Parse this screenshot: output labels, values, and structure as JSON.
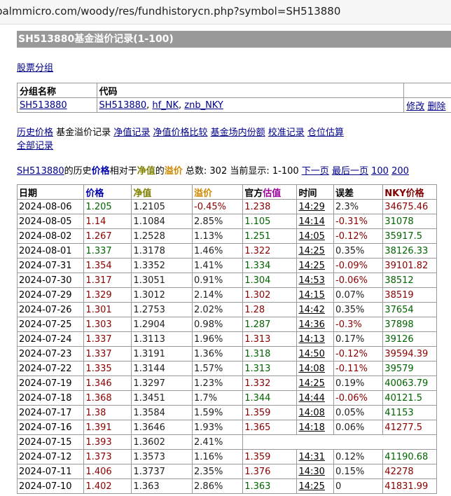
{
  "browser": {
    "url": "palmmicro.com/woody/res/fundhistorycn.php?symbol=SH513880"
  },
  "page_title": "SH513880基金溢价记录(1-100)",
  "group_link": "股票分组",
  "group_table": {
    "headers": [
      "分组名称",
      "代码"
    ],
    "name": "SH513880",
    "codes": [
      "SH513880",
      "hf_NK",
      "znb_NKY"
    ],
    "edit": "修改",
    "delete": "删除"
  },
  "nav_links": [
    "历史价格",
    "基金溢价记录",
    "净值记录",
    "净值价格比较",
    "基金场内份额",
    "校准记录",
    "仓位估算",
    "全部记录"
  ],
  "summary": {
    "symbol": "SH513880",
    "t1": "的历史",
    "price": "价格",
    "t2": "相对于",
    "nav": "净值",
    "t3": "的",
    "premium": "溢价",
    "total": "总数: 302 当前显示: 1-100",
    "next": "下一页",
    "last": "最后一页",
    "n100": "100",
    "n200": "200"
  },
  "table": {
    "headers": {
      "date": "日期",
      "price": "价格",
      "nav": "净值",
      "premium": "溢价",
      "est_prefix": "官方",
      "est": "估值",
      "time": "时间",
      "error": "误差",
      "nky": "NKY价格"
    },
    "rows": [
      {
        "date": "2024-08-06",
        "price": "1.205",
        "price_c": "green",
        "nav": "1.2105",
        "premium": "-0.45%",
        "est": "1.238",
        "est_c": "red",
        "time": "14:29",
        "err": "2.3%",
        "err_c": "dark",
        "nky": "34675.46",
        "nky_c": "red"
      },
      {
        "date": "2024-08-05",
        "price": "1.14",
        "price_c": "red",
        "nav": "1.1084",
        "premium": "2.85%",
        "est": "1.105",
        "est_c": "green",
        "time": "14:14",
        "err": "-0.31%",
        "err_c": "red",
        "nky": "31078",
        "nky_c": "green"
      },
      {
        "date": "2024-08-02",
        "price": "1.267",
        "price_c": "red",
        "nav": "1.2528",
        "premium": "1.13%",
        "est": "1.251",
        "est_c": "green",
        "time": "14:05",
        "err": "-0.12%",
        "err_c": "red",
        "nky": "35917.5",
        "nky_c": "green"
      },
      {
        "date": "2024-08-01",
        "price": "1.337",
        "price_c": "green",
        "nav": "1.3178",
        "premium": "1.46%",
        "est": "1.322",
        "est_c": "red",
        "time": "14:25",
        "err": "0.35%",
        "err_c": "dark",
        "nky": "38126.33",
        "nky_c": "green"
      },
      {
        "date": "2024-07-31",
        "price": "1.354",
        "price_c": "red",
        "nav": "1.3352",
        "premium": "1.41%",
        "est": "1.334",
        "est_c": "green",
        "time": "14:25",
        "err": "-0.09%",
        "err_c": "red",
        "nky": "39101.82",
        "nky_c": "red"
      },
      {
        "date": "2024-07-30",
        "price": "1.317",
        "price_c": "red",
        "nav": "1.3051",
        "premium": "0.91%",
        "est": "1.304",
        "est_c": "green",
        "time": "14:53",
        "err": "-0.06%",
        "err_c": "red",
        "nky": "38512",
        "nky_c": "green"
      },
      {
        "date": "2024-07-29",
        "price": "1.329",
        "price_c": "red",
        "nav": "1.3012",
        "premium": "2.14%",
        "est": "1.302",
        "est_c": "red",
        "time": "14:15",
        "err": "0.07%",
        "err_c": "dark",
        "nky": "38519",
        "nky_c": "red"
      },
      {
        "date": "2024-07-26",
        "price": "1.301",
        "price_c": "red",
        "nav": "1.2753",
        "premium": "2.02%",
        "est": "1.28",
        "est_c": "red",
        "time": "14:42",
        "err": "0.35%",
        "err_c": "dark",
        "nky": "37654",
        "nky_c": "green"
      },
      {
        "date": "2024-07-25",
        "price": "1.303",
        "price_c": "red",
        "nav": "1.2904",
        "premium": "0.98%",
        "est": "1.287",
        "est_c": "green",
        "time": "14:36",
        "err": "-0.3%",
        "err_c": "red",
        "nky": "37898",
        "nky_c": "green"
      },
      {
        "date": "2024-07-24",
        "price": "1.337",
        "price_c": "red",
        "nav": "1.3113",
        "premium": "1.96%",
        "est": "1.313",
        "est_c": "red",
        "time": "14:13",
        "err": "0.17%",
        "err_c": "dark",
        "nky": "39126",
        "nky_c": "green"
      },
      {
        "date": "2024-07-23",
        "price": "1.337",
        "price_c": "red",
        "nav": "1.3191",
        "premium": "1.36%",
        "est": "1.318",
        "est_c": "green",
        "time": "14:50",
        "err": "-0.12%",
        "err_c": "red",
        "nky": "39594.39",
        "nky_c": "red"
      },
      {
        "date": "2024-07-22",
        "price": "1.335",
        "price_c": "red",
        "nav": "1.3144",
        "premium": "1.57%",
        "est": "1.313",
        "est_c": "green",
        "time": "14:08",
        "err": "-0.11%",
        "err_c": "red",
        "nky": "39579",
        "nky_c": "green"
      },
      {
        "date": "2024-07-19",
        "price": "1.346",
        "price_c": "red",
        "nav": "1.3297",
        "premium": "1.23%",
        "est": "1.332",
        "est_c": "red",
        "time": "14:25",
        "err": "0.19%",
        "err_c": "dark",
        "nky": "40063.79",
        "nky_c": "green"
      },
      {
        "date": "2024-07-18",
        "price": "1.368",
        "price_c": "red",
        "nav": "1.3451",
        "premium": "1.7%",
        "est": "1.344",
        "est_c": "green",
        "time": "14:44",
        "err": "-0.06%",
        "err_c": "red",
        "nky": "40121.5",
        "nky_c": "green"
      },
      {
        "date": "2024-07-17",
        "price": "1.38",
        "price_c": "red",
        "nav": "1.3584",
        "premium": "1.59%",
        "est": "1.359",
        "est_c": "red",
        "time": "14:08",
        "err": "0.05%",
        "err_c": "dark",
        "nky": "41153",
        "nky_c": "green"
      },
      {
        "date": "2024-07-16",
        "price": "1.391",
        "price_c": "red",
        "nav": "1.3646",
        "premium": "1.93%",
        "est": "1.365",
        "est_c": "red",
        "time": "14:18",
        "err": "0.06%",
        "err_c": "dark",
        "nky": "41277.5",
        "nky_c": "red"
      },
      {
        "date": "2024-07-15",
        "price": "1.393",
        "price_c": "red",
        "nav": "1.3602",
        "premium": "2.41%",
        "est": "",
        "est_c": "dark",
        "time": "",
        "err": "",
        "err_c": "dark",
        "nky": "",
        "nky_c": "dark"
      },
      {
        "date": "2024-07-12",
        "price": "1.373",
        "price_c": "red",
        "nav": "1.3573",
        "premium": "1.16%",
        "est": "1.359",
        "est_c": "red",
        "time": "14:31",
        "err": "0.12%",
        "err_c": "dark",
        "nky": "41190.68",
        "nky_c": "green"
      },
      {
        "date": "2024-07-11",
        "price": "1.406",
        "price_c": "red",
        "nav": "1.3737",
        "premium": "2.35%",
        "est": "1.376",
        "est_c": "red",
        "time": "14:30",
        "err": "0.15%",
        "err_c": "dark",
        "nky": "42278",
        "nky_c": "red"
      },
      {
        "date": "2024-07-10",
        "price": "1.402",
        "price_c": "red",
        "nav": "1.363",
        "premium": "2.86%",
        "est": "1.363",
        "est_c": "green",
        "time": "14:25",
        "err": "0",
        "err_c": "dark",
        "nky": "41831.99",
        "nky_c": "red"
      }
    ]
  },
  "colors": {
    "red": "#8b0000",
    "green": "#006400",
    "link": "#00008b",
    "titlebar": "#999999"
  }
}
